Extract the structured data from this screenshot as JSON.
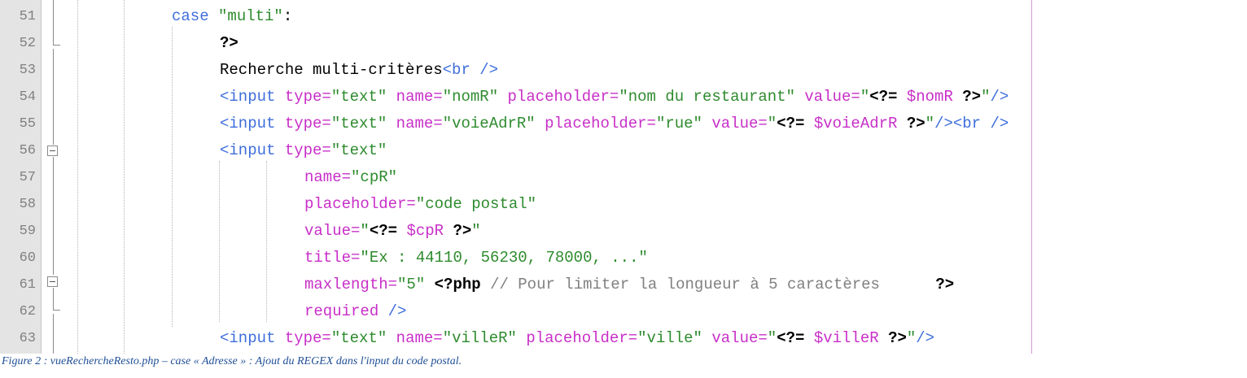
{
  "editor": {
    "line_numbers": [
      "51",
      "52",
      "53",
      "54",
      "55",
      "56",
      "57",
      "58",
      "59",
      "60",
      "61",
      "62",
      "63"
    ],
    "lines": {
      "l51": {
        "kw": "case",
        "s1": " ",
        "st": "\"multi\"",
        "tx": ":"
      },
      "l52": {
        "ph": "?>"
      },
      "l53": {
        "tx": "Recherche multi-critères",
        "tg": "<br />"
      },
      "l54": {
        "tg1": "<input",
        "s1": " ",
        "at1": "type=",
        "st1": "\"text\"",
        "s2": " ",
        "at2": "name=",
        "st2": "\"nomR\"",
        "s3": " ",
        "at3": "placeholder=",
        "st3": "\"nom du restaurant\"",
        "s4": " ",
        "at4": "value=",
        "st4a": "\"",
        "ph1": "<?=",
        "s5": " ",
        "va": "$nomR",
        "s6": " ",
        "ph2": "?>",
        "st4b": "\"",
        "tg2": "/>"
      },
      "l55": {
        "tg1": "<input",
        "s1": " ",
        "at1": "type=",
        "st1": "\"text\"",
        "s2": " ",
        "at2": "name=",
        "st2": "\"voieAdrR\"",
        "s3": " ",
        "at3": "placeholder=",
        "st3": "\"rue\"",
        "s4": " ",
        "at4": "value=",
        "st4a": "\"",
        "ph1": "<?=",
        "s5": " ",
        "va": "$voieAdrR",
        "s6": " ",
        "ph2": "?>",
        "st4b": "\"",
        "tg2": "/><br />"
      },
      "l56": {
        "tg1": "<input",
        "s1": " ",
        "at1": "type=",
        "st1": "\"text\""
      },
      "l57": {
        "at": "name=",
        "st": "\"cpR\""
      },
      "l58": {
        "at": "placeholder=",
        "st": "\"code postal\""
      },
      "l59": {
        "at": "value=",
        "st1": "\"",
        "ph1": "<?=",
        "s1": " ",
        "va": "$cpR",
        "s2": " ",
        "ph2": "?>",
        "st2": "\""
      },
      "l60": {
        "at": "title=",
        "st": "\"Ex : 44110, 56230, 78000, ...\""
      },
      "l61": {
        "at": "maxlength=",
        "st": "\"5\"",
        "s1": " ",
        "ph1": "<?php",
        "s2": " ",
        "cm": "// Pour limiter la longueur à 5 caractères",
        "s3": "      ",
        "ph2": "?>"
      },
      "l62": {
        "at": "required",
        "tg": " />"
      },
      "l63": {
        "tg1": "<input",
        "s1": " ",
        "at1": "type=",
        "st1": "\"text\"",
        "s2": " ",
        "at2": "name=",
        "st2": "\"villeR\"",
        "s3": " ",
        "at3": "placeholder=",
        "st3": "\"ville\"",
        "s4": " ",
        "at4": "value=",
        "st4a": "\"",
        "ph1": "<?=",
        "s5": " ",
        "va": "$villeR",
        "s6": " ",
        "ph2": "?>",
        "st4b": "\"",
        "tg2": "/>"
      }
    }
  },
  "caption": "Figure 2 : vueRechercheResto.php – case « Adresse » : Ajout du REGEX dans l'input du code postal.",
  "colors": {
    "keyword": "#3f6fdc",
    "string": "#2e8b2e",
    "attribute": "#c82fc8",
    "php_tag": "#000000",
    "variable": "#c82fc8",
    "comment": "#808080",
    "gutter_bg": "#e4e4e4",
    "edge_line": "#d59cd5",
    "caption": "#1f4e96"
  },
  "icons": {
    "fold": "fold-collapse-icon"
  }
}
